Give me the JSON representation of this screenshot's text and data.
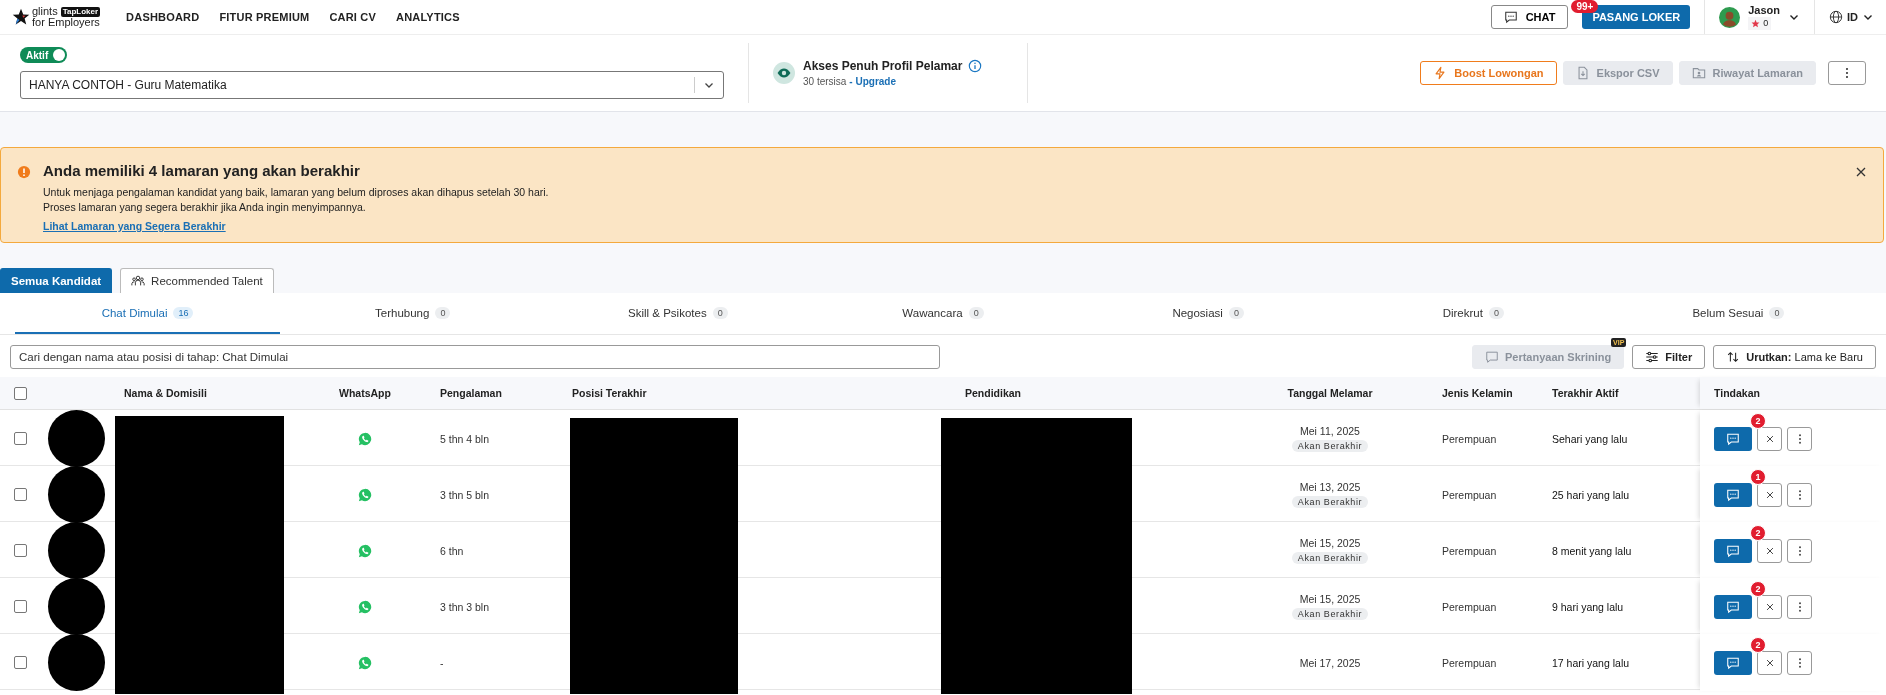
{
  "nav": {
    "logo": {
      "brand": "glints",
      "tag": "TapLoker",
      "sub": "for Employers"
    },
    "links": [
      "DASHBOARD",
      "FITUR PREMIUM",
      "CARI CV",
      "ANALYTICS"
    ],
    "chat": {
      "label": "CHAT",
      "badge": "99+"
    },
    "post_button": "PASANG LOKER",
    "user": {
      "name": "Jason",
      "points": "0"
    },
    "language": "ID"
  },
  "job_bar": {
    "status": {
      "label": "Aktif",
      "on": true
    },
    "job_select": {
      "value": "HANYA CONTOH - Guru Matematika"
    },
    "access": {
      "title": "Akses Penuh Profil Pelamar",
      "remaining": "30 tersisa",
      "upgrade": "- Upgrade"
    },
    "actions": [
      {
        "kind": "boost",
        "label": "Boost Lowongan",
        "disabled": false
      },
      {
        "kind": "export",
        "label": "Ekspor CSV",
        "disabled": true
      },
      {
        "kind": "history",
        "label": "Riwayat Lamaran",
        "disabled": true
      }
    ]
  },
  "alert": {
    "title": "Anda memiliki 4 lamaran yang akan berakhir",
    "lines": [
      "Untuk menjaga pengalaman kandidat yang baik, lamaran yang belum diproses akan dihapus setelah 30 hari.",
      "Proses lamaran yang segera berakhir jika Anda ingin menyimpannya."
    ],
    "link": "Lihat Lamaran yang Segera Berakhir"
  },
  "view_tabs": [
    {
      "label": "Semua Kandidat",
      "selected": true
    },
    {
      "label": "Recommended Talent",
      "selected": false
    }
  ],
  "stage_tabs": [
    {
      "label": "Chat Dimulai",
      "count": "16",
      "selected": true
    },
    {
      "label": "Terhubung",
      "count": "0",
      "selected": false
    },
    {
      "label": "Skill & Psikotes",
      "count": "0",
      "selected": false
    },
    {
      "label": "Wawancara",
      "count": "0",
      "selected": false
    },
    {
      "label": "Negosiasi",
      "count": "0",
      "selected": false
    },
    {
      "label": "Direkrut",
      "count": "0",
      "selected": false
    },
    {
      "label": "Belum Sesuai",
      "count": "0",
      "selected": false
    }
  ],
  "search": {
    "placeholder": "Cari dengan nama atau posisi di tahap: Chat Dimulai"
  },
  "tools": {
    "screening": {
      "label": "Pertanyaan Skrining",
      "badge": "VIP",
      "disabled": true
    },
    "filter": "Filter",
    "sort": "**Urutkan:** Lama ke Baru"
  },
  "table": {
    "select_all": {
      "checked": false
    },
    "columns": [
      "Nama & Domisili",
      "WhatsApp",
      "Pengalaman",
      "Posisi Terakhir",
      "Pendidikan",
      "Tanggal Melamar",
      "Jenis Kelamin",
      "Terakhir Aktif",
      "Tindakan"
    ],
    "rows": [
      {
        "checked": false,
        "experience": "5 thn 4 bln",
        "applied": "Mei 11, 2025",
        "tag": "Akan Berakhir",
        "gender": "Perempuan",
        "last_active": "Sehari yang lalu",
        "unread": "2"
      },
      {
        "checked": false,
        "experience": "3 thn 5 bln",
        "applied": "Mei 13, 2025",
        "tag": "Akan Berakhir",
        "gender": "Perempuan",
        "last_active": "25 hari yang lalu",
        "unread": "1"
      },
      {
        "checked": false,
        "experience": "6 thn",
        "applied": "Mei 15, 2025",
        "tag": "Akan Berakhir",
        "gender": "Perempuan",
        "last_active": "8 menit yang lalu",
        "unread": "2"
      },
      {
        "checked": false,
        "experience": "3 thn 3 bln",
        "applied": "Mei 15, 2025",
        "tag": "Akan Berakhir",
        "gender": "Perempuan",
        "last_active": "9 hari yang lalu",
        "unread": "2"
      },
      {
        "checked": false,
        "experience": "-",
        "applied": "Mei 17, 2025",
        "gender": "Perempuan",
        "last_active": "17 hari yang lalu",
        "unread": "2"
      }
    ]
  }
}
